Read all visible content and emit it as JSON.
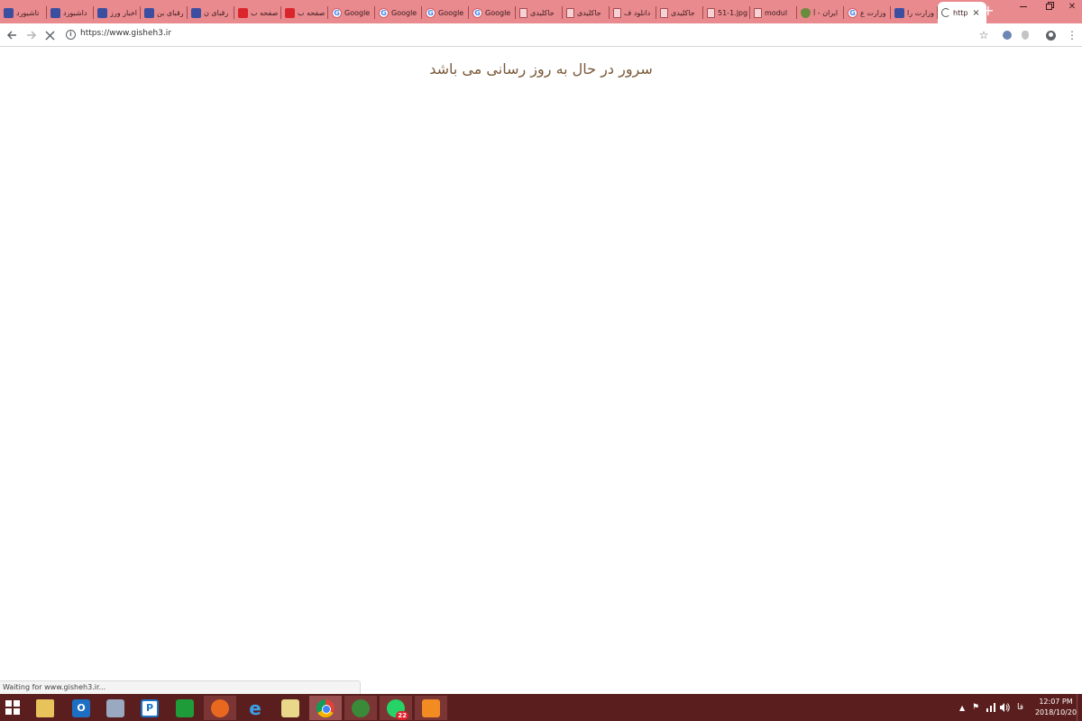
{
  "browser": {
    "tabs": [
      {
        "label": "تاشیورد",
        "favicon": "uni-icon"
      },
      {
        "label": "داشبورد",
        "favicon": "uni-icon"
      },
      {
        "label": "اخبار ورز",
        "favicon": "uni-icon"
      },
      {
        "label": "رقبای بن",
        "favicon": "uni-icon"
      },
      {
        "label": "رقبای ن",
        "favicon": "uni-icon"
      },
      {
        "label": "صفحه ب",
        "favicon": "red-icon"
      },
      {
        "label": "صفحه ب",
        "favicon": "red-icon"
      },
      {
        "label": "Google",
        "favicon": "google-icon"
      },
      {
        "label": "Google",
        "favicon": "google-icon"
      },
      {
        "label": "Google",
        "favicon": "google-icon"
      },
      {
        "label": "Google",
        "favicon": "google-icon"
      },
      {
        "label": "جاکلیدی",
        "favicon": "doc-icon"
      },
      {
        "label": "جاکلیدی",
        "favicon": "doc-icon"
      },
      {
        "label": "دانلود ف",
        "favicon": "doc-icon"
      },
      {
        "label": "جاکلیدی",
        "favicon": "doc-icon"
      },
      {
        "label": "51-1.jpg",
        "favicon": "doc-icon"
      },
      {
        "label": "modul",
        "favicon": "doc-icon"
      },
      {
        "label": "ایران - آ",
        "favicon": "shield-icon"
      },
      {
        "label": "وزارت ع",
        "favicon": "google-icon"
      },
      {
        "label": "وزارت را",
        "favicon": "uni-icon"
      }
    ],
    "active_tab": {
      "label": "http",
      "close": "×"
    },
    "new_tab": "+",
    "address": "https://www.gisheh3.ir",
    "info_glyph": "i",
    "window_controls": {
      "minimize": "",
      "maximize": "",
      "close": "✕"
    }
  },
  "page": {
    "message": "سرور در حال به روز رسانی می باشد"
  },
  "status_bar": {
    "text": "Waiting for www.gisheh3.ir..."
  },
  "taskbar": {
    "apps": [
      {
        "name": "file-explorer"
      },
      {
        "name": "outlook",
        "glyph": "O"
      },
      {
        "name": "calculator"
      },
      {
        "name": "pdf-reader",
        "glyph": "P"
      },
      {
        "name": "store"
      },
      {
        "name": "firefox"
      },
      {
        "name": "internet-explorer",
        "glyph": "e"
      },
      {
        "name": "notes"
      },
      {
        "name": "chrome"
      },
      {
        "name": "globe"
      },
      {
        "name": "whatsapp",
        "badge": "22"
      },
      {
        "name": "app-orange"
      }
    ],
    "tray": {
      "lang": "فا",
      "time": "12:07 PM",
      "date": "2018/10/20"
    }
  }
}
